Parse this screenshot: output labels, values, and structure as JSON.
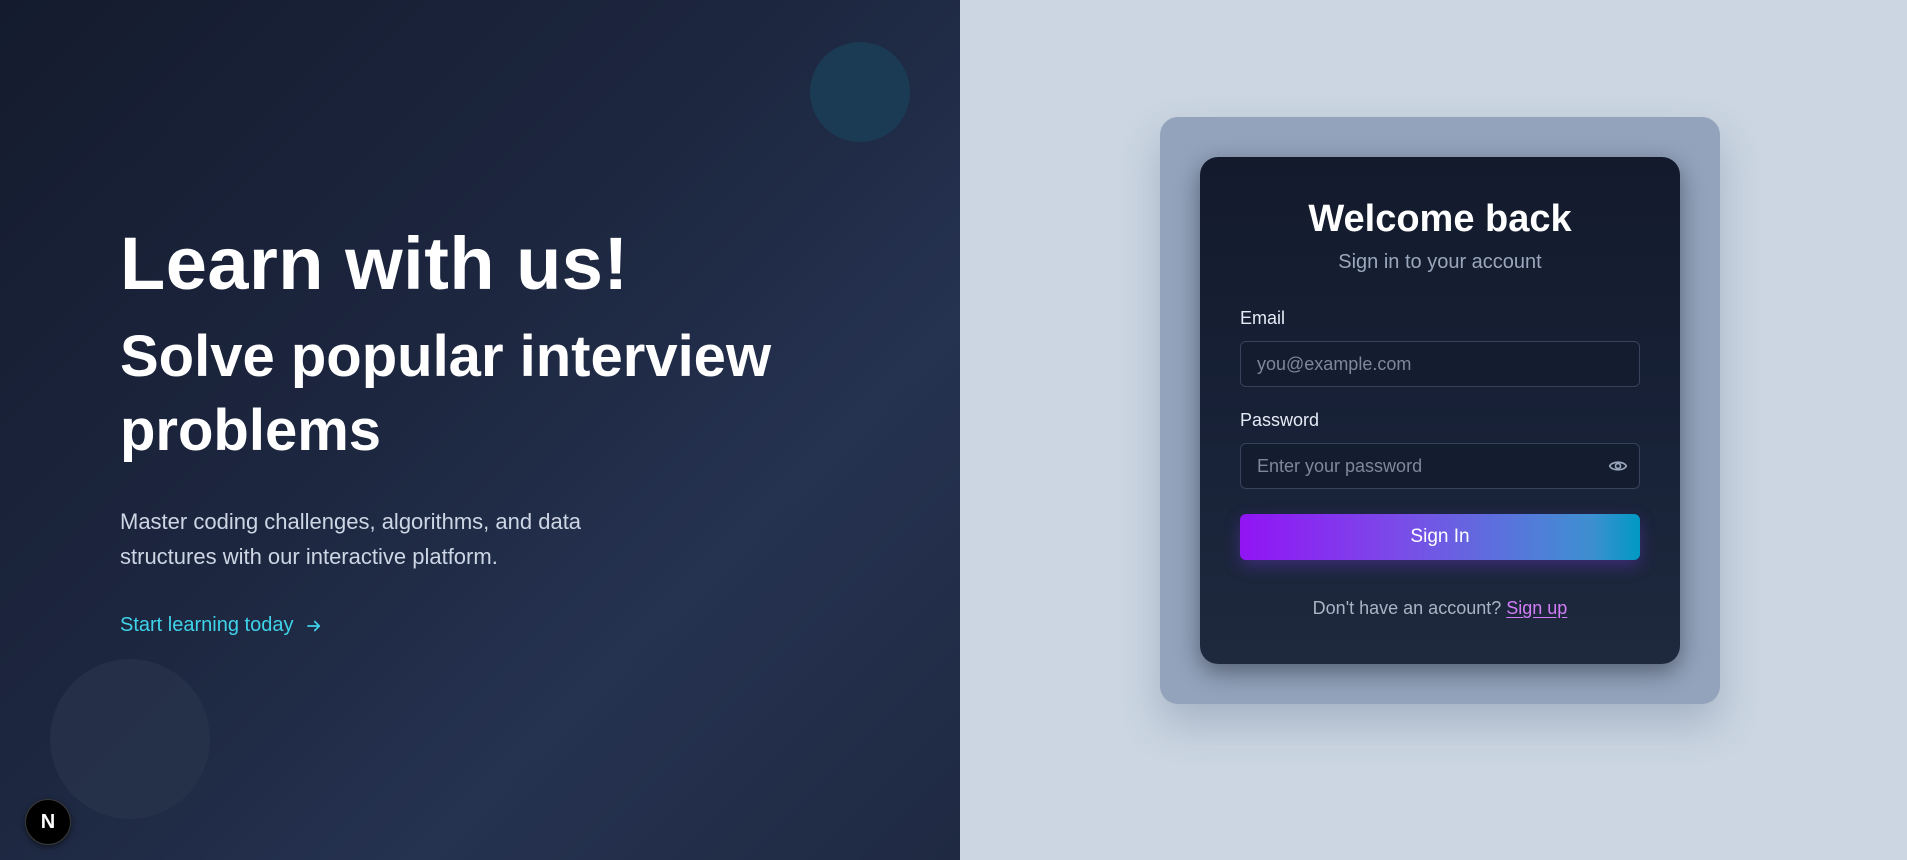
{
  "hero": {
    "title": "Learn with us!",
    "subtitle": "Solve popular interview problems",
    "description": "Master coding challenges, algorithms, and data structures with our interactive platform.",
    "cta_label": "Start learning today",
    "cta_icon": "arrow-right-icon",
    "badge_letter": "N"
  },
  "auth": {
    "title": "Welcome back",
    "subtitle": "Sign in to your account",
    "email_label": "Email",
    "email_placeholder": "you@example.com",
    "email_value": "",
    "password_label": "Password",
    "password_placeholder": "Enter your password",
    "password_value": "",
    "password_toggle_icon": "eye-icon",
    "submit_label": "Sign In",
    "signup_prompt": "Don't have an account?",
    "signup_link": "Sign up"
  },
  "colors": {
    "hero_bg": "#1d2740",
    "accent_cyan": "#3fd3ea",
    "auth_bg": "#cbd6e2",
    "frame": "#93a3bb",
    "card_bg": "#131a2c",
    "button_start": "#9114f5",
    "button_end": "#0099c4",
    "link_pink": "#d27cf7"
  }
}
